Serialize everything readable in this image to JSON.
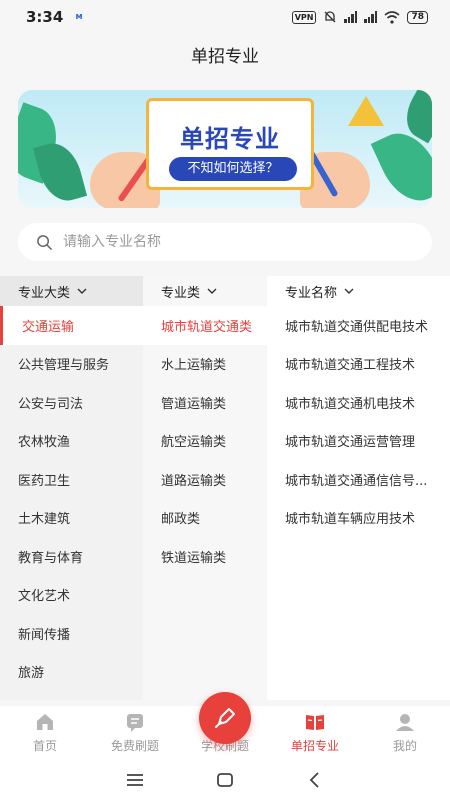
{
  "status_bar": {
    "time": "3:34",
    "notification": "ᴍ",
    "vpn": "VPN",
    "signal1": "4G",
    "signal2": "4G",
    "battery": "78"
  },
  "header": {
    "title": "单招专业"
  },
  "banner": {
    "title": "单招专业",
    "subtitle": "不知如何选择？"
  },
  "search": {
    "placeholder": "请输入专业名称",
    "value": ""
  },
  "columns": {
    "category": {
      "header": "专业大类",
      "items": [
        "交通运输",
        "公共管理与服务",
        "公安与司法",
        "农林牧渔",
        "医药卫生",
        "土木建筑",
        "教育与体育",
        "文化艺术",
        "新闻传播",
        "旅游"
      ],
      "selected_index": 0
    },
    "subcategory": {
      "header": "专业类",
      "items": [
        "城市轨道交通类",
        "水上运输类",
        "管道运输类",
        "航空运输类",
        "道路运输类",
        "邮政类",
        "铁道运输类"
      ],
      "selected_index": 0
    },
    "major": {
      "header": "专业名称",
      "items": [
        "城市轨道交通供配电技术",
        "城市轨道交通工程技术",
        "城市轨道交通机电技术",
        "城市轨道交通运营管理",
        "城市轨道交通通信信号...",
        "城市轨道车辆应用技术"
      ]
    }
  },
  "bottom_nav": {
    "items": [
      {
        "label": "首页",
        "icon": "home-icon"
      },
      {
        "label": "免费刷题",
        "icon": "document-icon"
      },
      {
        "label": "学校刷题",
        "icon": "pen-icon"
      },
      {
        "label": "单招专业",
        "icon": "book-icon"
      },
      {
        "label": "我的",
        "icon": "user-icon"
      }
    ],
    "active_index": 3
  },
  "colors": {
    "accent": "#e8403b",
    "banner_blue": "#2a47b8"
  }
}
